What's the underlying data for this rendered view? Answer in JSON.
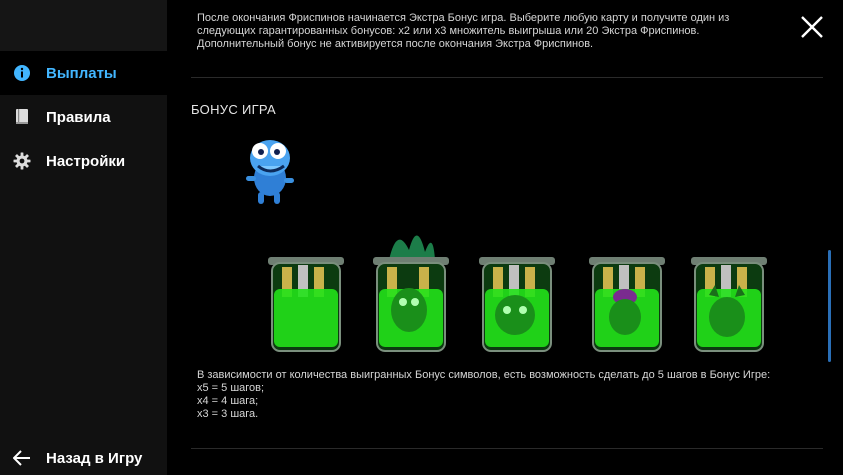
{
  "sidebar": {
    "items": [
      {
        "label": "Выплаты",
        "icon": "info-icon",
        "active": true
      },
      {
        "label": "Правила",
        "icon": "book-icon",
        "active": false
      },
      {
        "label": "Настройки",
        "icon": "gear-icon",
        "active": false
      }
    ],
    "back_label": "Назад в Игру",
    "active_color": "#42b6ff"
  },
  "content": {
    "intro_text": "После окончания Фриспинов начинается Экстра Бонус игра. Выберите любую карту и получите один из следующих гарантированных бонусов: x2 или x3 множитель выигрыша или 20 Экстра Фриспинов. Дополнительный бонус не активируется после окончания Экстра Фриспинов.",
    "section_title": "БОНУС ИГРА",
    "bonus_description": {
      "line1": "В зависимости от количества выигранных Бонус символов, есть возможность сделать до 5 шагов в Бонус Игре:",
      "line2": "x5 = 5 шагов;",
      "line3": "x4 = 4 шага;",
      "line4": "x3 = 3 шага."
    }
  }
}
